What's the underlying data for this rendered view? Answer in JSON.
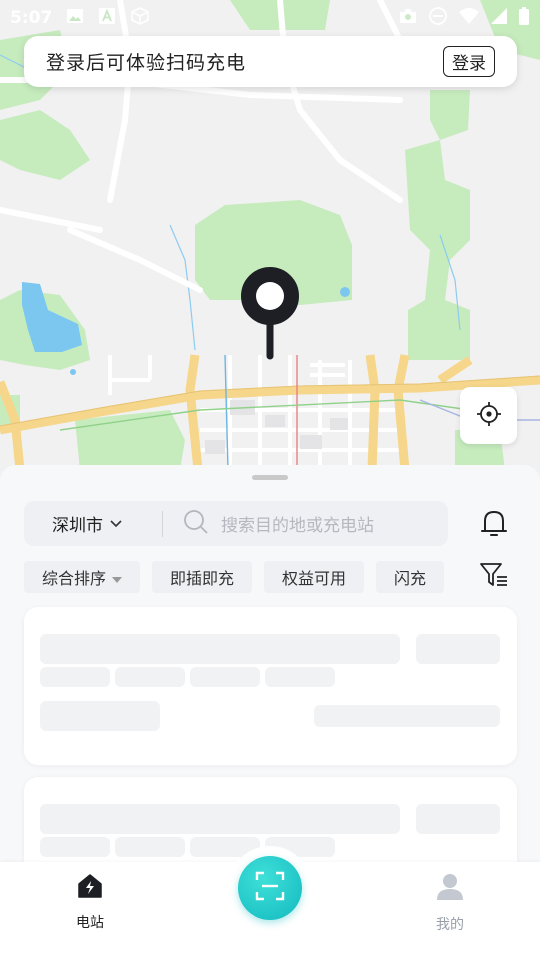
{
  "status_bar": {
    "time": "5:07",
    "left_icons": [
      "image-icon",
      "font-icon",
      "cube-icon"
    ],
    "right_icons": [
      "camera-icon",
      "do-not-disturb-icon",
      "wifi-icon",
      "cellular-icon",
      "battery-icon"
    ]
  },
  "login_banner": {
    "text": "登录后可体验扫码充电",
    "button_label": "登录"
  },
  "map": {
    "colors": {
      "background": "#f1f1f1",
      "green": "#c8edc0",
      "water": "#7fc8f0",
      "road_major": "#f7d98c",
      "road_minor": "#ffffff"
    }
  },
  "search": {
    "city": "深圳市",
    "placeholder": "搜索目的地或充电站"
  },
  "filters": [
    {
      "label": "综合排序",
      "has_caret": true
    },
    {
      "label": "即插即充"
    },
    {
      "label": "权益可用"
    },
    {
      "label": "闪充"
    }
  ],
  "tab_bar": {
    "items": [
      {
        "label": "电站",
        "icon": "station-icon",
        "active": true
      },
      {
        "label": "我的",
        "icon": "user-icon",
        "active": false
      }
    ],
    "center_button_icon": "scan-icon",
    "accent": "#12b9bf"
  }
}
